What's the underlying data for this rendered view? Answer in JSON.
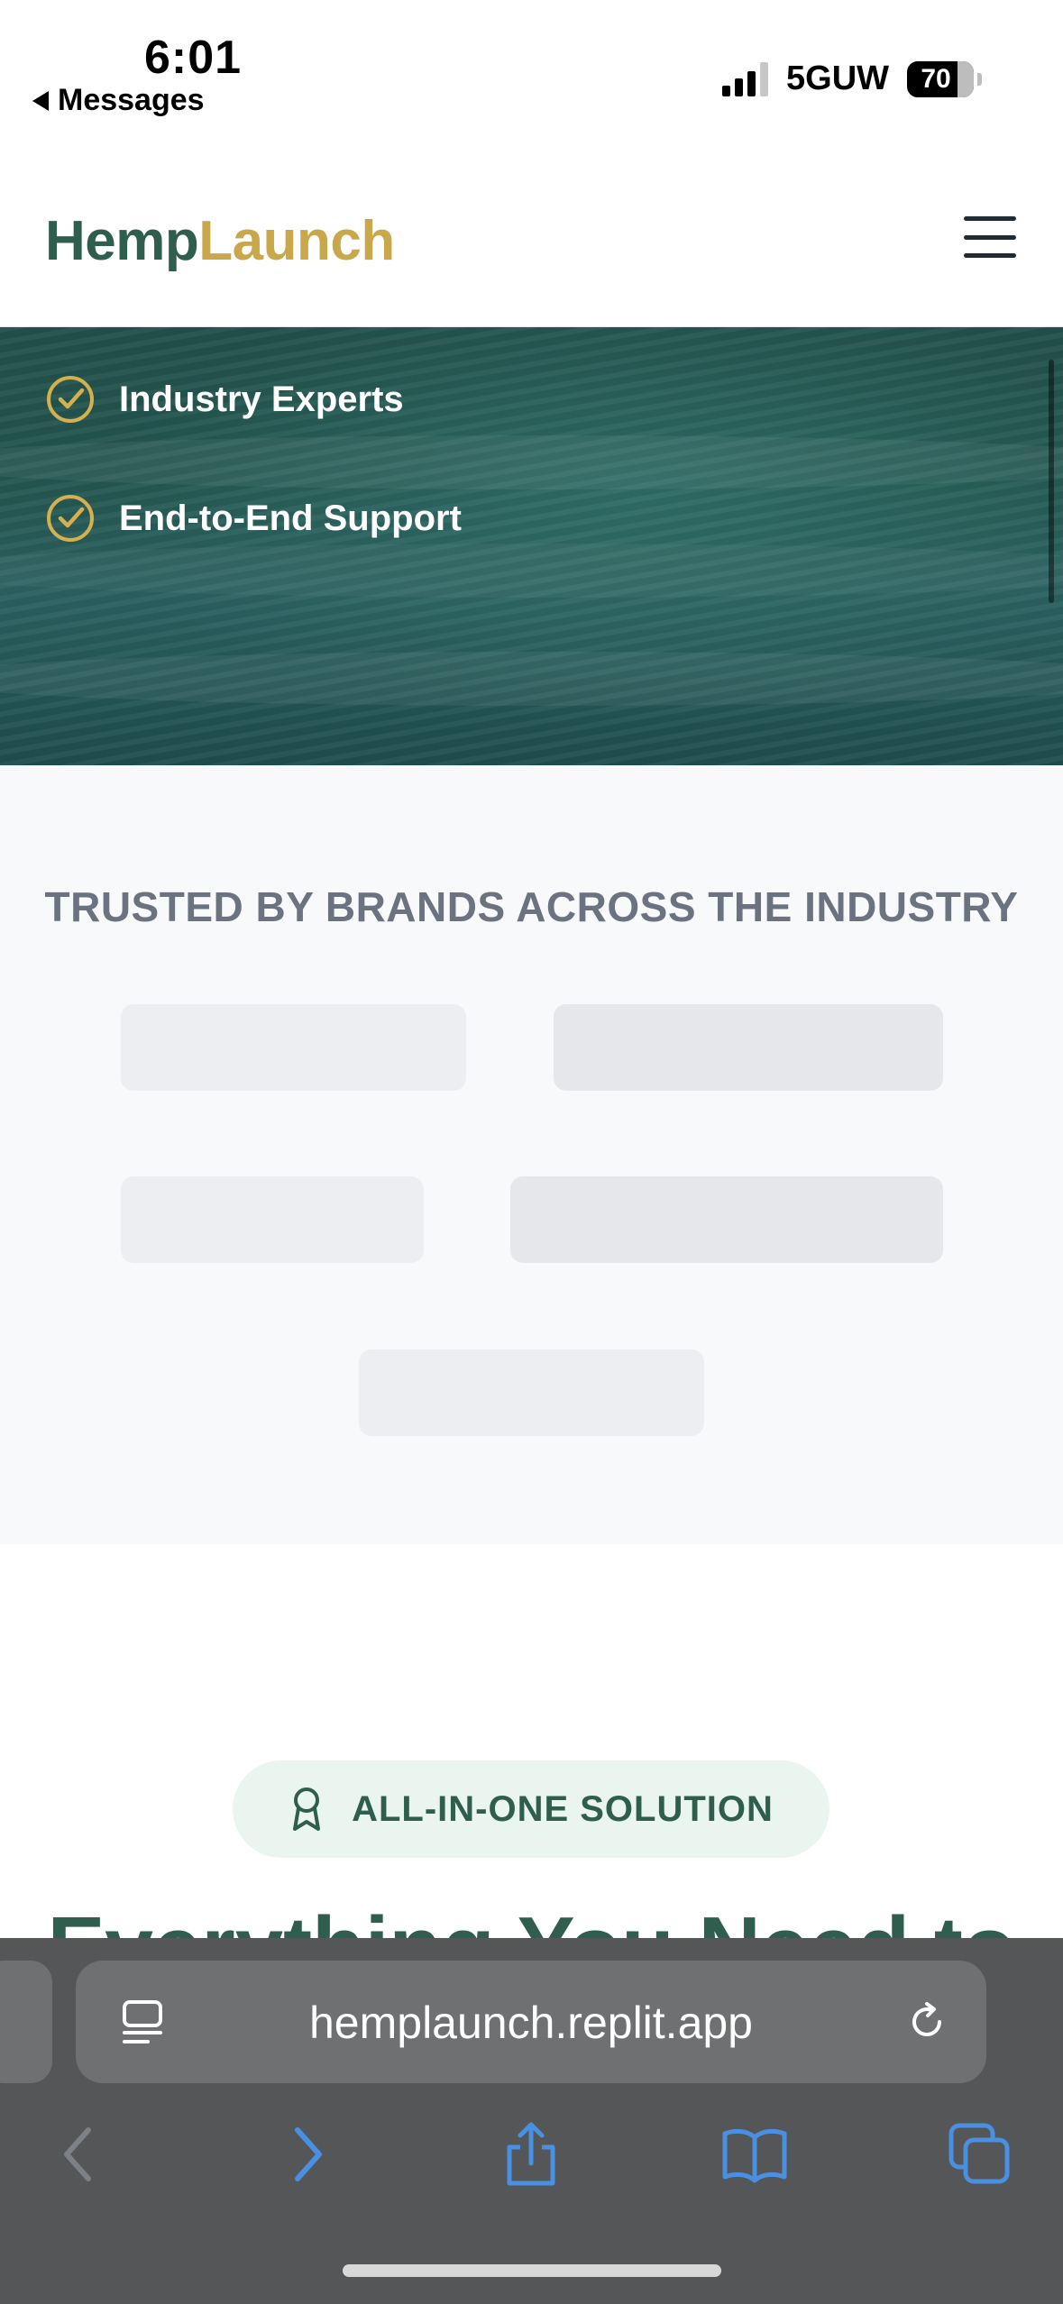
{
  "status": {
    "time": "6:01",
    "back_label": "Messages",
    "network": "5GUW",
    "battery": "70"
  },
  "header": {
    "logo_part1": "Hemp",
    "logo_part2": "Launch"
  },
  "hero": {
    "features": [
      "Industry Experts",
      "End-to-End Support"
    ]
  },
  "trusted": {
    "title": "TRUSTED BY BRANDS ACROSS THE INDUSTRY"
  },
  "solution": {
    "badge": "ALL-IN-ONE SOLUTION",
    "heading": "Everything You Need to"
  },
  "browser": {
    "url": "hemplaunch.replit.app"
  },
  "colors": {
    "brand_green": "#2f5d4e",
    "brand_gold": "#c8a84b",
    "browser_accent": "#4a90e2"
  }
}
